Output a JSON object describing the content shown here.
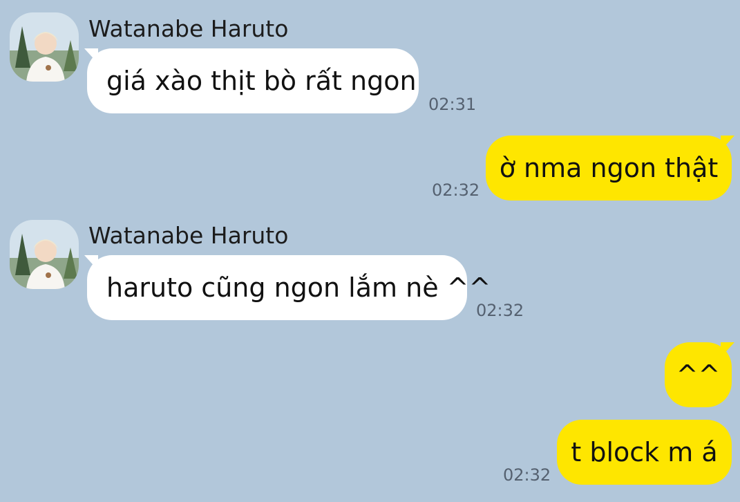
{
  "chat": {
    "background_color": "#b2c7da",
    "incoming_bubble_color": "#ffffff",
    "outgoing_bubble_color": "#fee600",
    "messages": [
      {
        "direction": "incoming",
        "sender": "Watanabe Haruto",
        "text": "giá xào thịt bò rất ngon",
        "time": "02:31"
      },
      {
        "direction": "outgoing",
        "text": "ờ nma ngon thật",
        "time": "02:32"
      },
      {
        "direction": "incoming",
        "sender": "Watanabe Haruto",
        "text": "haruto cũng ngon lắm nè ^^",
        "time": "02:32"
      },
      {
        "direction": "outgoing",
        "text": "^^",
        "time": ""
      },
      {
        "direction": "outgoing",
        "text": "t block m á",
        "time": "02:32"
      }
    ]
  }
}
